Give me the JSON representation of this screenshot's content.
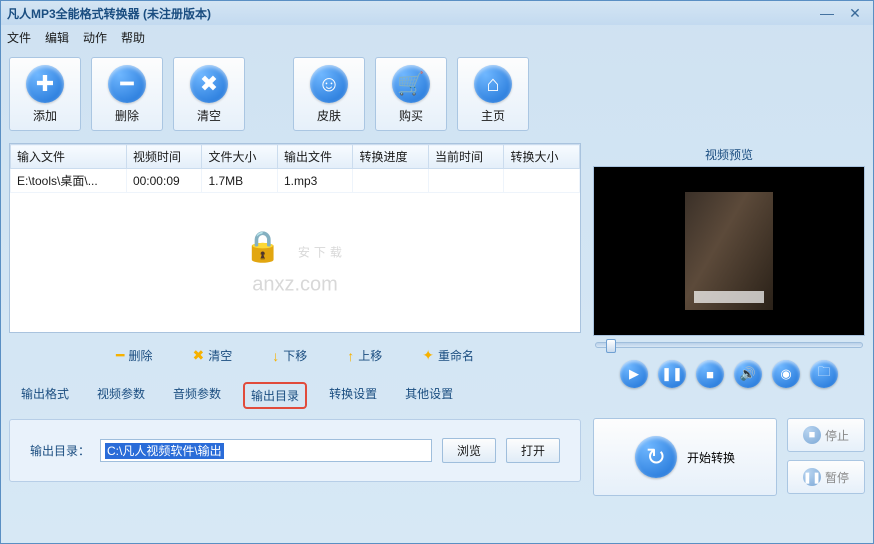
{
  "window": {
    "title": "凡人MP3全能格式转换器   (未注册版本)"
  },
  "menu": {
    "file": "文件",
    "edit": "编辑",
    "action": "动作",
    "help": "帮助"
  },
  "toolbar": {
    "add": "添加",
    "delete": "删除",
    "clear": "清空",
    "skin": "皮肤",
    "buy": "购买",
    "home": "主页"
  },
  "table": {
    "headers": {
      "input": "输入文件",
      "duration": "视频时间",
      "size": "文件大小",
      "output": "输出文件",
      "progress": "转换进度",
      "current": "当前时间",
      "convsize": "转换大小"
    },
    "rows": [
      {
        "input": "E:\\tools\\桌面\\...",
        "duration": "00:00:09",
        "size": "1.7MB",
        "output": "1.mp3",
        "progress": "",
        "current": "",
        "convsize": ""
      }
    ]
  },
  "watermark": {
    "line1": "安下载",
    "line2": "anxz.com"
  },
  "listops": {
    "delete": "删除",
    "clear": "清空",
    "down": "下移",
    "up": "上移",
    "rename": "重命名"
  },
  "tabs": {
    "format": "输出格式",
    "vparams": "视频参数",
    "aparams": "音频参数",
    "outdir": "输出目录",
    "convset": "转换设置",
    "other": "其他设置"
  },
  "outdir": {
    "label": "输出目录：",
    "path": "C:\\凡人视频软件\\输出",
    "browse": "浏览",
    "open": "打开"
  },
  "preview": {
    "title": "视频预览"
  },
  "actions": {
    "start": "开始转换",
    "stop": "停止",
    "pause": "暂停"
  }
}
